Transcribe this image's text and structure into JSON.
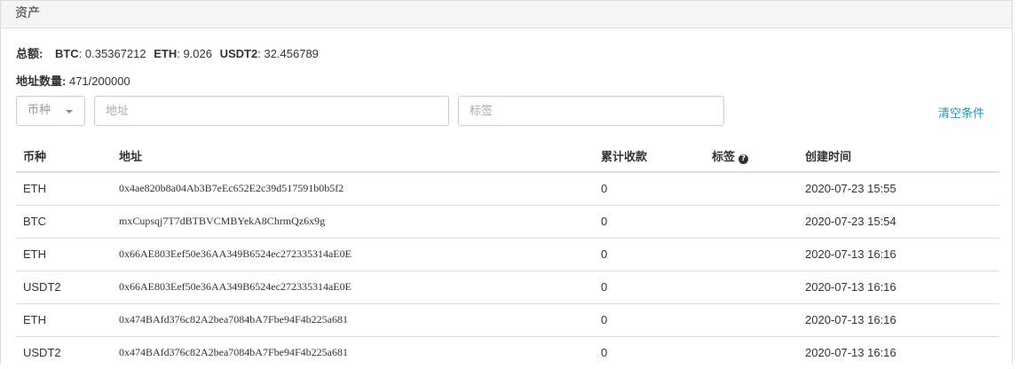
{
  "panel": {
    "title": "资产"
  },
  "summary": {
    "total_label": "总额:",
    "balances": [
      {
        "coin": "BTC",
        "value": ": 0.35367212"
      },
      {
        "coin": "ETH",
        "value": ": 9.026"
      },
      {
        "coin": "USDT2",
        "value": ": 32.456789"
      }
    ],
    "address_count_label": "地址数量:",
    "address_count_value": "471/200000"
  },
  "filters": {
    "coin_select_placeholder": "币种",
    "address_placeholder": "地址",
    "tag_placeholder": "标签",
    "clear_label": "清空条件"
  },
  "table": {
    "columns": [
      "币种",
      "地址",
      "累计收款",
      "标签",
      "创建时间"
    ],
    "rows": [
      {
        "coin": "ETH",
        "address": "0x4ae820b8a04Ab3B7eEc652E2c39d517591b0b5f2",
        "received": "0",
        "tag": "",
        "created": "2020-07-23 15:55"
      },
      {
        "coin": "BTC",
        "address": "mxCupsqj7T7dBTBVCMBYekA8ChrmQz6x9g",
        "received": "0",
        "tag": "",
        "created": "2020-07-23 15:54"
      },
      {
        "coin": "ETH",
        "address": "0x66AE803Eef50e36AA349B6524ec272335314aE0E",
        "received": "0",
        "tag": "",
        "created": "2020-07-13 16:16"
      },
      {
        "coin": "USDT2",
        "address": "0x66AE803Eef50e36AA349B6524ec272335314aE0E",
        "received": "0",
        "tag": "",
        "created": "2020-07-13 16:16"
      },
      {
        "coin": "ETH",
        "address": "0x474BAfd376c82A2bea7084bA7Fbe94F4b225a681",
        "received": "0",
        "tag": "",
        "created": "2020-07-13 16:16"
      },
      {
        "coin": "USDT2",
        "address": "0x474BAfd376c82A2bea7084bA7Fbe94F4b225a681",
        "received": "0",
        "tag": "",
        "created": "2020-07-13 16:16"
      }
    ]
  }
}
